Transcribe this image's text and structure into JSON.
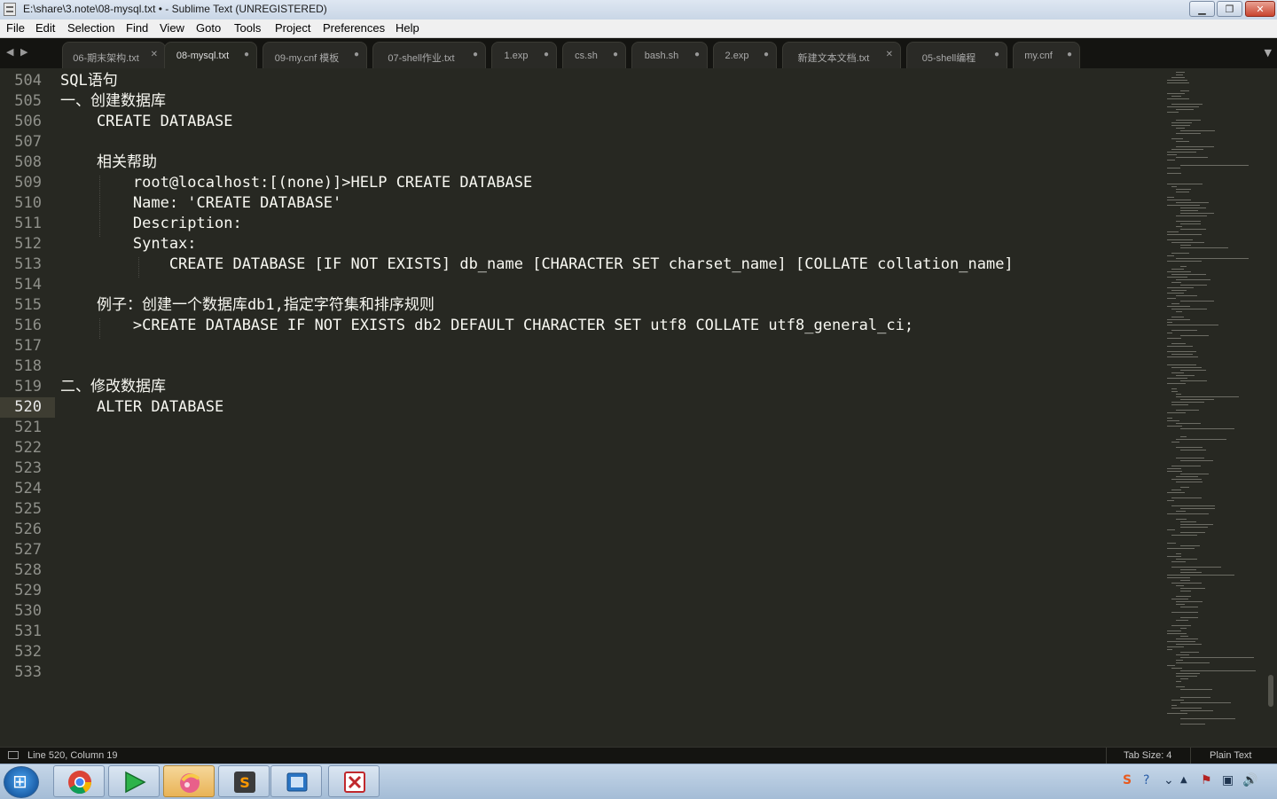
{
  "window": {
    "title": "E:\\share\\3.note\\08-mysql.txt • - Sublime Text (UNREGISTERED)",
    "minimize": "▁",
    "maximize": "❐",
    "close": "✕"
  },
  "menu": [
    "File",
    "Edit",
    "Selection",
    "Find",
    "View",
    "Goto",
    "Tools",
    "Project",
    "Preferences",
    "Help"
  ],
  "tab_nav": {
    "left": "◀",
    "right": "▶",
    "menu": "▼"
  },
  "tabs": [
    {
      "label": "06-期末架构.txt",
      "close": "✕"
    },
    {
      "label": "08-mysql.txt",
      "close": "●"
    },
    {
      "label": "09-my.cnf 模板",
      "close": "●"
    },
    {
      "label": "07-shell作业.txt",
      "close": "●"
    },
    {
      "label": "1.exp",
      "close": "●"
    },
    {
      "label": "cs.sh",
      "close": "●"
    },
    {
      "label": "bash.sh",
      "close": "●"
    },
    {
      "label": "2.exp",
      "close": "●"
    },
    {
      "label": "新建文本文档.txt",
      "close": "✕"
    },
    {
      "label": "05-shell编程",
      "close": "●"
    },
    {
      "label": "my.cnf",
      "close": "●"
    }
  ],
  "editor": {
    "current_line": 520,
    "lines": [
      {
        "no": "504",
        "text": "SQL语句"
      },
      {
        "no": "505",
        "text": "一、创建数据库"
      },
      {
        "no": "506",
        "text": "    CREATE DATABASE"
      },
      {
        "no": "507",
        "text": ""
      },
      {
        "no": "508",
        "text": "    相关帮助"
      },
      {
        "no": "509",
        "text": "        root@localhost:[(none)]>HELP CREATE DATABASE"
      },
      {
        "no": "510",
        "text": "        Name: 'CREATE DATABASE'"
      },
      {
        "no": "511",
        "text": "        Description:"
      },
      {
        "no": "512",
        "text": "        Syntax:"
      },
      {
        "no": "513",
        "text": "            CREATE DATABASE [IF NOT EXISTS] db_name [CHARACTER SET charset_name] [COLLATE collation_name]"
      },
      {
        "no": "514",
        "text": ""
      },
      {
        "no": "515",
        "text": "    例子：创建一个数据库db1,指定字符集和排序规则"
      },
      {
        "no": "516",
        "text": "        >CREATE DATABASE IF NOT EXISTS db2 DEFAULT CHARACTER SET utf8 COLLATE utf8_general_ci;"
      },
      {
        "no": "517",
        "text": ""
      },
      {
        "no": "518",
        "text": ""
      },
      {
        "no": "519",
        "text": "二、修改数据库"
      },
      {
        "no": "520",
        "text": "    ALTER DATABASE"
      },
      {
        "no": "521",
        "text": ""
      },
      {
        "no": "522",
        "text": ""
      },
      {
        "no": "523",
        "text": ""
      },
      {
        "no": "524",
        "text": ""
      },
      {
        "no": "525",
        "text": ""
      },
      {
        "no": "526",
        "text": ""
      },
      {
        "no": "527",
        "text": ""
      },
      {
        "no": "528",
        "text": ""
      },
      {
        "no": "529",
        "text": ""
      },
      {
        "no": "530",
        "text": ""
      },
      {
        "no": "531",
        "text": ""
      },
      {
        "no": "532",
        "text": ""
      },
      {
        "no": "533",
        "text": ""
      }
    ]
  },
  "status": {
    "position": "Line 520, Column 19",
    "tab_size": "Tab Size: 4",
    "syntax": "Plain Text"
  },
  "taskbar": {
    "items": [
      "chrome-icon",
      "media-player-icon",
      "paint-icon",
      "sublime-text-icon",
      "virtualbox-icon",
      "xshell-icon"
    ],
    "tray": [
      "S",
      "?",
      "⌄",
      "▲",
      "⚑",
      "▣",
      "🔊"
    ]
  },
  "colors": {
    "editor_bg": "#272822",
    "text": "#f8f8f2",
    "gutter_text": "#8f908a",
    "tab_bar": "#141411"
  }
}
